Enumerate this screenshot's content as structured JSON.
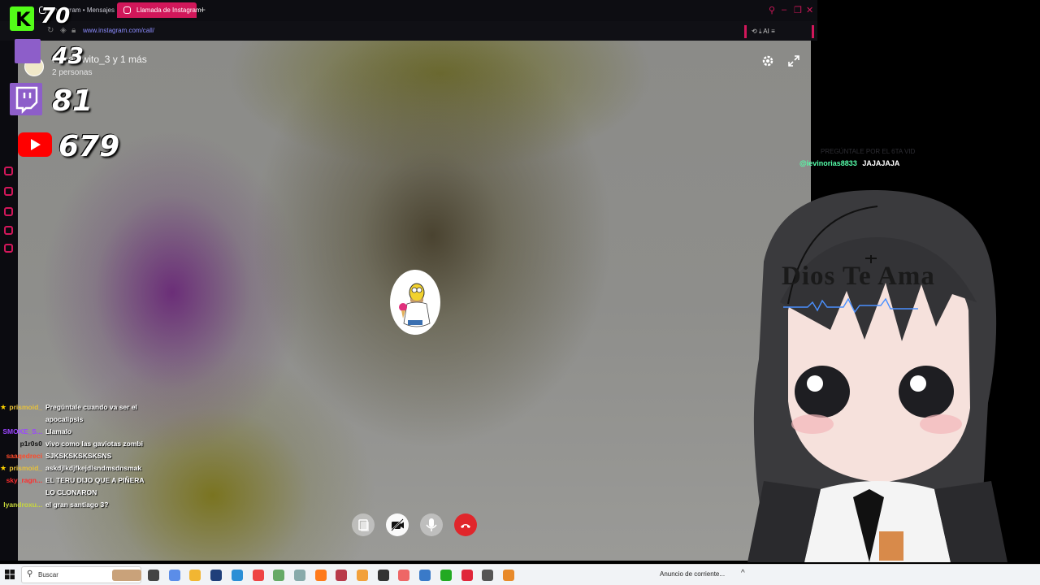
{
  "browser": {
    "tabs": [
      {
        "label": "Instagram • Mensajes"
      },
      {
        "label": "Llamada de Instagram"
      }
    ],
    "new_tab": "+",
    "url": "www.instagram.com/call/",
    "url_right_label": "AI"
  },
  "call": {
    "title": "tomatewito_3 y 1 más",
    "subtitle": "2 personas"
  },
  "stream": {
    "kick_count": "70",
    "twitch_count_small": "43",
    "twitch_count": "81",
    "youtube_count": "679"
  },
  "chat": [
    {
      "user": "prismoid_",
      "color": "#e8c23a",
      "star": true,
      "lines": [
        "Pregúntale cuando va ser el",
        "apocalipsis"
      ]
    },
    {
      "user": "SMOKE_S...",
      "color": "#9b45ff",
      "star": false,
      "lines": [
        "Llamalo"
      ]
    },
    {
      "user": "p1r0s0",
      "color": "#111111",
      "star": false,
      "lines": [
        "vivo como las gaviotas zombi"
      ]
    },
    {
      "user": "saaqedreci",
      "color": "#ff4a2a",
      "star": false,
      "lines": [
        "SJKSKSKSKSKSNS"
      ]
    },
    {
      "user": "prismoid_",
      "color": "#e8c23a",
      "star": true,
      "lines": [
        "askdjlkdjfkejdlsndmsdnsmak"
      ]
    },
    {
      "user": "sky_ragn...",
      "color": "#ff2d2d",
      "star": false,
      "lines": [
        "EL TERU DIJO QUE A PIÑERA",
        "LO CLONARON"
      ]
    },
    {
      "user": "lyandroxu...",
      "color": "#c9d93a",
      "star": false,
      "lines": [
        "el gran santiago 3?"
      ]
    }
  ],
  "right_chat": {
    "ghost": "PREGÚNTALE POR EL 6TA VID",
    "user": "@ievinorias8833",
    "text": "JAJAJAJA"
  },
  "banner": "Dios Te Ama",
  "taskbar": {
    "search_placeholder": "Buscar",
    "notification": "Anuncio de corriente...",
    "chevron": "^"
  },
  "colors": {
    "accent": "#d1175a",
    "kick": "#53fc18",
    "twitch": "#8d5ec9",
    "youtube": "#ff0000",
    "end_call": "#e0262b"
  }
}
